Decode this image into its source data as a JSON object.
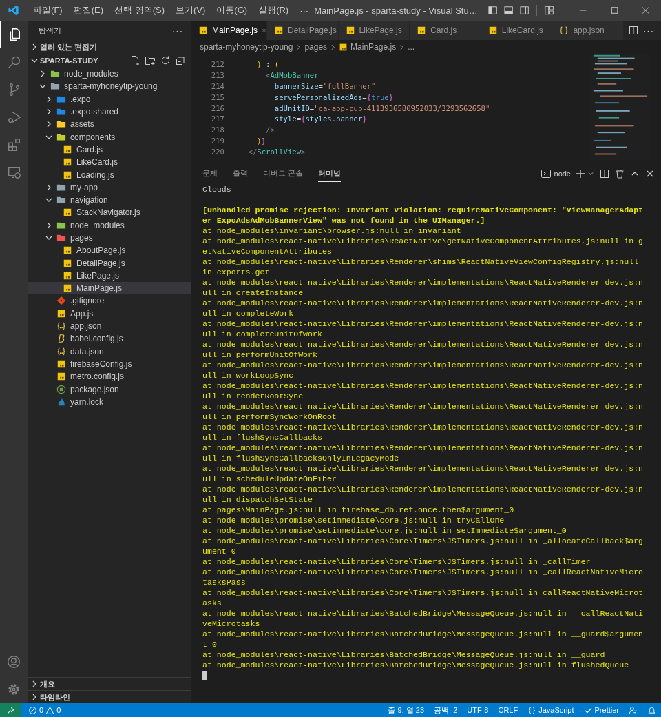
{
  "title_bar": {
    "menus": [
      "파일(F)",
      "편집(E)",
      "선택 영역(S)",
      "보기(V)",
      "이동(G)",
      "실행(R)"
    ],
    "more": "···",
    "title": "MainPage.js - sparta-study - Visual Stu…"
  },
  "activity_bar": [
    {
      "kind": "explorer",
      "selected": true
    },
    {
      "kind": "search",
      "selected": false
    },
    {
      "kind": "source-control",
      "selected": false
    },
    {
      "kind": "run",
      "selected": false
    },
    {
      "kind": "extensions",
      "selected": false
    },
    {
      "kind": "remote",
      "selected": false
    }
  ],
  "sidebar": {
    "title": "탐색기",
    "more": "···",
    "open_editors": {
      "label": "열려 있는 편집기",
      "expanded": false
    },
    "project": {
      "label": "SPARTA-STUDY",
      "expanded": true,
      "tree": [
        {
          "label": "node_modules",
          "kind": "folder",
          "color": "#8bc34a",
          "expanded": false,
          "selected": false
        },
        {
          "label": "sparta-myhoneytip-young",
          "kind": "folder",
          "color": "#90a4ae",
          "expanded": true,
          "selected": false,
          "children": [
            {
              "label": ".expo",
              "kind": "folder",
              "color": "#1e88e5",
              "expanded": false,
              "selected": false
            },
            {
              "label": ".expo-shared",
              "kind": "folder",
              "color": "#1e88e5",
              "expanded": false,
              "selected": false
            },
            {
              "label": "assets",
              "kind": "folder",
              "color": "#ffca28",
              "expanded": false,
              "selected": false
            },
            {
              "label": "components",
              "kind": "folder",
              "color": "#c0ca33",
              "expanded": true,
              "selected": false,
              "children": [
                {
                  "label": "Card.js",
                  "kind": "js",
                  "selected": false
                },
                {
                  "label": "LikeCard.js",
                  "kind": "js",
                  "selected": false
                },
                {
                  "label": "Loading.js",
                  "kind": "js",
                  "selected": false
                }
              ]
            },
            {
              "label": "my-app",
              "kind": "folder",
              "color": "#90a4ae",
              "expanded": false,
              "selected": false
            },
            {
              "label": "navigation",
              "kind": "folder",
              "color": "#90a4ae",
              "expanded": true,
              "selected": false,
              "children": [
                {
                  "label": "StackNavigator.js",
                  "kind": "js",
                  "selected": false
                }
              ]
            },
            {
              "label": "node_modules",
              "kind": "folder",
              "color": "#8bc34a",
              "expanded": false,
              "selected": false
            },
            {
              "label": "pages",
              "kind": "folder",
              "color": "#ef5350",
              "expanded": true,
              "selected": false,
              "children": [
                {
                  "label": "AboutPage.js",
                  "kind": "js",
                  "selected": false
                },
                {
                  "label": "DetailPage.js",
                  "kind": "js",
                  "selected": false
                },
                {
                  "label": "LikePage.js",
                  "kind": "js",
                  "selected": false
                },
                {
                  "label": "MainPage.js",
                  "kind": "js",
                  "selected": true
                }
              ]
            },
            {
              "label": ".gitignore",
              "kind": "git",
              "selected": false
            },
            {
              "label": "App.js",
              "kind": "js",
              "selected": false
            },
            {
              "label": "app.json",
              "kind": "json",
              "selected": false
            },
            {
              "label": "babel.config.js",
              "kind": "babel",
              "selected": false
            },
            {
              "label": "data.json",
              "kind": "json",
              "selected": false
            },
            {
              "label": "firebaseConfig.js",
              "kind": "js",
              "selected": false
            },
            {
              "label": "metro.config.js",
              "kind": "js",
              "selected": false
            },
            {
              "label": "package.json",
              "kind": "npm",
              "selected": false
            },
            {
              "label": "yarn.lock",
              "kind": "yarn",
              "selected": false
            }
          ]
        }
      ]
    },
    "outline": {
      "label": "개요",
      "expanded": false
    },
    "timeline": {
      "label": "타임라인",
      "expanded": false
    }
  },
  "editor": {
    "tabs": [
      {
        "label": "MainPage.js",
        "kind": "js",
        "selected": true
      },
      {
        "label": "DetailPage.js",
        "kind": "js",
        "selected": false
      },
      {
        "label": "LikePage.js",
        "kind": "js",
        "selected": false
      },
      {
        "label": "Card.js",
        "kind": "js",
        "selected": false
      },
      {
        "label": "LikeCard.js",
        "kind": "js",
        "selected": false
      },
      {
        "label": "app.json",
        "kind": "json",
        "selected": false
      }
    ],
    "more": "···",
    "breadcrumb": [
      {
        "text": "sparta-myhoneytip-young",
        "kind": "folder"
      },
      {
        "text": "pages",
        "kind": "folder"
      },
      {
        "text": "MainPage.js",
        "kind": "js"
      },
      {
        "text": "...",
        "kind": "symbol"
      }
    ],
    "code": [
      {
        "number": "212",
        "tokens": [
          {
            "text": "      )",
            "kind": "bracket"
          },
          {
            "text": " : ",
            "kind": "op"
          },
          {
            "text": "(",
            "kind": "bracket"
          }
        ]
      },
      {
        "number": "213",
        "tokens": [
          {
            "text": "        <",
            "kind": "punct"
          },
          {
            "text": "AdMobBanner",
            "kind": "tag"
          }
        ]
      },
      {
        "number": "214",
        "tokens": [
          {
            "text": "          bannerSize",
            "kind": "attr"
          },
          {
            "text": "=",
            "kind": "op"
          },
          {
            "text": "\"fullBanner\"",
            "kind": "string"
          }
        ]
      },
      {
        "number": "215",
        "tokens": [
          {
            "text": "          servePersonalizedAds",
            "kind": "attr"
          },
          {
            "text": "=",
            "kind": "op"
          },
          {
            "text": "{",
            "kind": "bracket2"
          },
          {
            "text": "true",
            "kind": "keyword"
          },
          {
            "text": "}",
            "kind": "bracket2"
          }
        ]
      },
      {
        "number": "216",
        "tokens": [
          {
            "text": "          adUnitID",
            "kind": "attr"
          },
          {
            "text": "=",
            "kind": "op"
          },
          {
            "text": "\"ca-app-pub-4113936580952033/3293562658\"",
            "kind": "string"
          }
        ]
      },
      {
        "number": "217",
        "tokens": [
          {
            "text": "          style",
            "kind": "attr"
          },
          {
            "text": "=",
            "kind": "op"
          },
          {
            "text": "{",
            "kind": "bracket2"
          },
          {
            "text": "styles.banner",
            "kind": "var"
          },
          {
            "text": "}",
            "kind": "bracket2"
          }
        ]
      },
      {
        "number": "218",
        "tokens": [
          {
            "text": "        />",
            "kind": "punct"
          }
        ]
      },
      {
        "number": "219",
        "tokens": [
          {
            "text": "      )",
            "kind": "bracket"
          },
          {
            "text": "}",
            "kind": "bracket2"
          }
        ]
      },
      {
        "number": "220",
        "tokens": [
          {
            "text": "    </",
            "kind": "punct"
          },
          {
            "text": "ScrollView",
            "kind": "tag"
          },
          {
            "text": ">",
            "kind": "punct"
          }
        ]
      }
    ]
  },
  "panel": {
    "tabs": [
      {
        "label": "문제",
        "selected": false
      },
      {
        "label": "출력",
        "selected": false
      },
      {
        "label": "디버그 콘솔",
        "selected": false
      },
      {
        "label": "터미널",
        "selected": true
      }
    ],
    "terminal_name": "node",
    "lines": [
      {
        "text": "Clouds",
        "kind": "log"
      },
      {
        "text": "[Unhandled promise rejection: Invariant Violation: requireNativeComponent: \"ViewManagerAdapt",
        "kind": "error"
      },
      {
        "text": "er_ExpoAdsAdMobBannerView\" was not found in the UIManager.]",
        "kind": "error"
      },
      {
        "text": "at node_modules\\invariant\\browser.js:null in invariant",
        "kind": "trace"
      },
      {
        "text": "at node_modules\\react-native\\Libraries\\ReactNative\\getNativeComponentAttributes.js:null in g",
        "kind": "trace"
      },
      {
        "text": "etNativeComponentAttributes",
        "kind": "trace"
      },
      {
        "text": "at node_modules\\react-native\\Libraries\\Renderer\\shims\\ReactNativeViewConfigRegistry.js:null",
        "kind": "trace"
      },
      {
        "text": "in exports.get",
        "kind": "trace"
      },
      {
        "text": "at node_modules\\react-native\\Libraries\\Renderer\\implementations\\ReactNativeRenderer-dev.js:n",
        "kind": "trace"
      },
      {
        "text": "ull in createInstance",
        "kind": "trace"
      },
      {
        "text": "at node_modules\\react-native\\Libraries\\Renderer\\implementations\\ReactNativeRenderer-dev.js:n",
        "kind": "trace"
      },
      {
        "text": "ull in completeWork",
        "kind": "trace"
      },
      {
        "text": "at node_modules\\react-native\\Libraries\\Renderer\\implementations\\ReactNativeRenderer-dev.js:n",
        "kind": "trace"
      },
      {
        "text": "ull in completeUnitOfWork",
        "kind": "trace"
      },
      {
        "text": "at node_modules\\react-native\\Libraries\\Renderer\\implementations\\ReactNativeRenderer-dev.js:n",
        "kind": "trace"
      },
      {
        "text": "ull in performUnitOfWork",
        "kind": "trace"
      },
      {
        "text": "at node_modules\\react-native\\Libraries\\Renderer\\implementations\\ReactNativeRenderer-dev.js:n",
        "kind": "trace"
      },
      {
        "text": "ull in workLoopSync",
        "kind": "trace"
      },
      {
        "text": "at node_modules\\react-native\\Libraries\\Renderer\\implementations\\ReactNativeRenderer-dev.js:n",
        "kind": "trace"
      },
      {
        "text": "ull in renderRootSync",
        "kind": "trace"
      },
      {
        "text": "at node_modules\\react-native\\Libraries\\Renderer\\implementations\\ReactNativeRenderer-dev.js:n",
        "kind": "trace"
      },
      {
        "text": "ull in performSyncWorkOnRoot",
        "kind": "trace"
      },
      {
        "text": "at node_modules\\react-native\\Libraries\\Renderer\\implementations\\ReactNativeRenderer-dev.js:n",
        "kind": "trace"
      },
      {
        "text": "ull in flushSyncCallbacks",
        "kind": "trace"
      },
      {
        "text": "at node_modules\\react-native\\Libraries\\Renderer\\implementations\\ReactNativeRenderer-dev.js:n",
        "kind": "trace"
      },
      {
        "text": "ull in flushSyncCallbacksOnlyInLegacyMode",
        "kind": "trace"
      },
      {
        "text": "at node_modules\\react-native\\Libraries\\Renderer\\implementations\\ReactNativeRenderer-dev.js:n",
        "kind": "trace"
      },
      {
        "text": "ull in scheduleUpdateOnFiber",
        "kind": "trace"
      },
      {
        "text": "at node_modules\\react-native\\Libraries\\Renderer\\implementations\\ReactNativeRenderer-dev.js:n",
        "kind": "trace"
      },
      {
        "text": "ull in dispatchSetState",
        "kind": "trace"
      },
      {
        "text": "at pages\\MainPage.js:null in firebase_db.ref.once.then$argument_0",
        "kind": "trace"
      },
      {
        "text": "at node_modules\\promise\\setimmediate\\core.js:null in tryCallOne",
        "kind": "trace"
      },
      {
        "text": "at node_modules\\promise\\setimmediate\\core.js:null in setImmediate$argument_0",
        "kind": "trace"
      },
      {
        "text": "at node_modules\\react-native\\Libraries\\Core\\Timers\\JSTimers.js:null in _allocateCallback$arg",
        "kind": "trace"
      },
      {
        "text": "ument_0",
        "kind": "trace"
      },
      {
        "text": "at node_modules\\react-native\\Libraries\\Core\\Timers\\JSTimers.js:null in _callTimer",
        "kind": "trace"
      },
      {
        "text": "at node_modules\\react-native\\Libraries\\Core\\Timers\\JSTimers.js:null in _callReactNativeMicro",
        "kind": "trace"
      },
      {
        "text": "tasksPass",
        "kind": "trace"
      },
      {
        "text": "at node_modules\\react-native\\Libraries\\Core\\Timers\\JSTimers.js:null in callReactNativeMicrot",
        "kind": "trace"
      },
      {
        "text": "asks",
        "kind": "trace"
      },
      {
        "text": "at node_modules\\react-native\\Libraries\\BatchedBridge\\MessageQueue.js:null in __callReactNati",
        "kind": "trace"
      },
      {
        "text": "veMicrotasks",
        "kind": "trace"
      },
      {
        "text": "at node_modules\\react-native\\Libraries\\BatchedBridge\\MessageQueue.js:null in __guard$argumen",
        "kind": "trace"
      },
      {
        "text": "t_0",
        "kind": "trace"
      },
      {
        "text": "at node_modules\\react-native\\Libraries\\BatchedBridge\\MessageQueue.js:null in __guard",
        "kind": "trace"
      },
      {
        "text": "at node_modules\\react-native\\Libraries\\BatchedBridge\\MessageQueue.js:null in flushedQueue",
        "kind": "trace"
      }
    ]
  },
  "status_bar": {
    "errors": "0",
    "warnings": "0",
    "items": [
      "줄 9, 열 23",
      "공백: 2",
      "UTF-8",
      "CRLF"
    ],
    "language": "JavaScript",
    "formatter": "Prettier"
  }
}
